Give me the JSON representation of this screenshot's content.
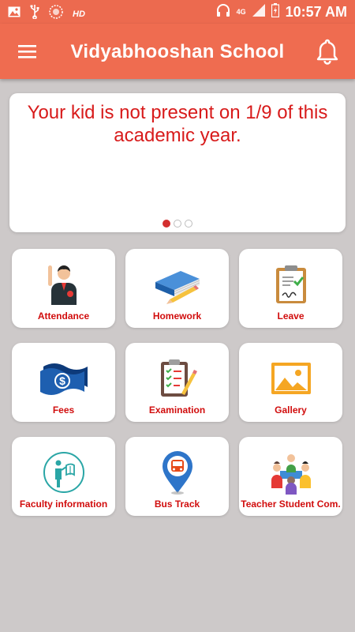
{
  "status_bar": {
    "network": "4G",
    "hd": "HD",
    "time": "10:57 AM"
  },
  "app_bar": {
    "title": "Vidyabhooshan School"
  },
  "banner": {
    "message": "Your kid is not present on 1/9 of this academic year.",
    "slide_count": 3,
    "active_slide": 1
  },
  "tiles": [
    {
      "label": "Attendance",
      "icon": "attendance-icon"
    },
    {
      "label": "Homework",
      "icon": "homework-icon"
    },
    {
      "label": "Leave",
      "icon": "leave-icon"
    },
    {
      "label": "Fees",
      "icon": "fees-icon"
    },
    {
      "label": "Examination",
      "icon": "examination-icon"
    },
    {
      "label": "Gallery",
      "icon": "gallery-icon"
    },
    {
      "label": "Faculty information",
      "icon": "faculty-icon"
    },
    {
      "label": "Bus Track",
      "icon": "bus-track-icon"
    },
    {
      "label": "Teacher Student Com.",
      "icon": "teacher-student-icon"
    }
  ],
  "colors": {
    "app_bar": "#ef6c50",
    "status_bar": "#ec6a4f",
    "accent_text": "#d10d0d",
    "background": "#cdc9c9"
  }
}
